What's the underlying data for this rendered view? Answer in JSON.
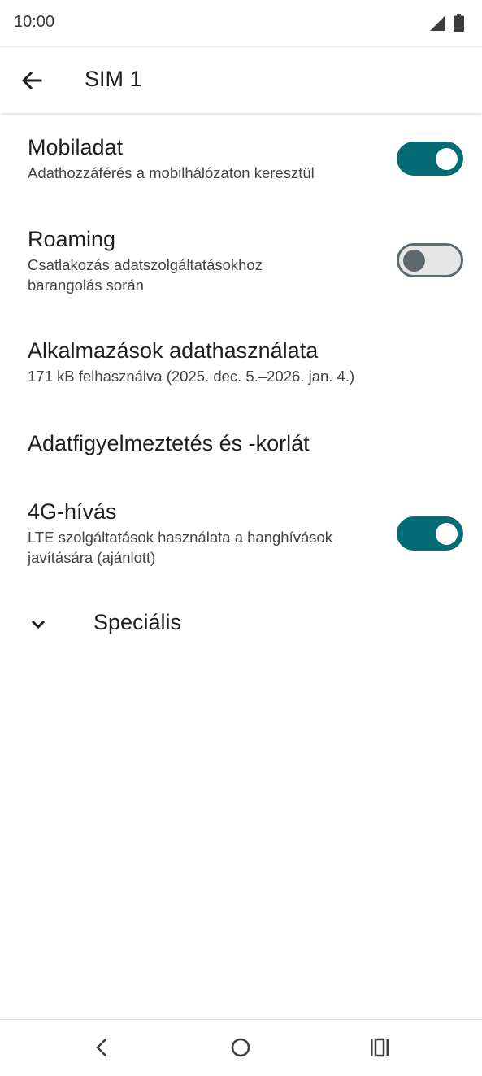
{
  "status_bar": {
    "time": "10:00",
    "signal_icon": "cell-signal-icon",
    "battery_icon": "battery-icon"
  },
  "app_bar": {
    "back_icon": "arrow-back-icon",
    "title": "SIM 1"
  },
  "preferences": [
    {
      "title": "Mobiladat",
      "summary": "Adathozzáférés a mobilhálózaton keresztül",
      "toggle": true
    },
    {
      "title": "Roaming",
      "summary": "Csatlakozás adatszolgáltatásokhoz barangolás során",
      "toggle": false
    },
    {
      "title": "Alkalmazások adathasználata",
      "summary": "171 kB felhasználva (2025. dec. 5.–2026. jan. 4.)"
    },
    {
      "title": "Adatfigyelmeztetés és -korlát"
    },
    {
      "title": "4G-hívás",
      "summary": "LTE szolgáltatások használata a hanghívások javítására (ajánlott)",
      "toggle": true
    }
  ],
  "advanced": {
    "label": "Speciális",
    "icon": "chevron-down-icon"
  },
  "nav_bar": {
    "back_icon": "nav-back-icon",
    "home_icon": "nav-home-icon",
    "recents_icon": "nav-recents-icon"
  },
  "colors": {
    "switch_on": "#056b74",
    "switch_off_track": "#e6e6e6",
    "switch_off_thumb": "#5e686d"
  }
}
